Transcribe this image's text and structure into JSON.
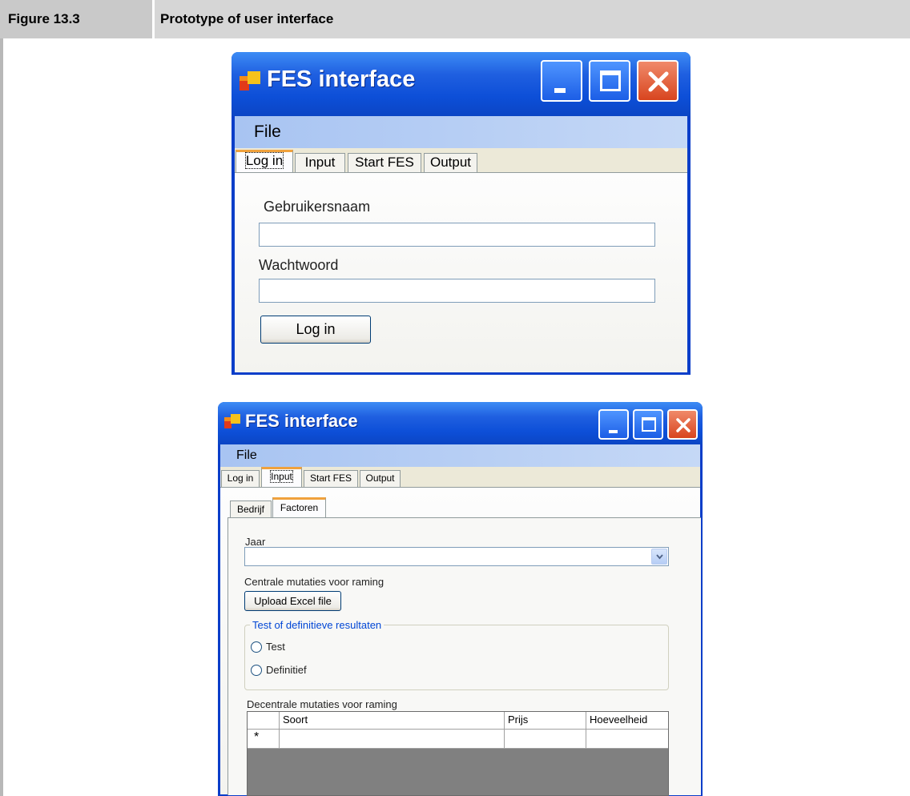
{
  "figure": {
    "number": "Figure 13.3",
    "title": "Prototype of user interface"
  },
  "window1": {
    "title": "FES interface",
    "menu": {
      "file": "File"
    },
    "tabs": [
      "Log in",
      "Input",
      "Start FES",
      "Output"
    ],
    "active_tab": "Log in",
    "username_label": "Gebruikersnaam",
    "username_value": "",
    "password_label": "Wachtwoord",
    "password_value": "",
    "login_button": "Log in"
  },
  "window2": {
    "title": "FES interface",
    "menu": {
      "file": "File"
    },
    "tabs": [
      "Log in",
      "Input",
      "Start FES",
      "Output"
    ],
    "active_tab": "Input",
    "subtabs": [
      "Bedrijf",
      "Factoren"
    ],
    "active_subtab": "Factoren",
    "jaar_label": "Jaar",
    "jaar_value": "",
    "central_label": "Centrale mutaties voor raming",
    "upload_button": "Upload Excel file",
    "group_title": "Test of definitieve resultaten",
    "radio_test": "Test",
    "radio_definitief": "Definitief",
    "decentral_label": "Decentrale mutaties voor raming",
    "grid": {
      "columns": [
        "Soort",
        "Prijs",
        "Hoeveelheid"
      ],
      "new_row_marker": "*"
    }
  },
  "colors": {
    "title_bar": "#0d4fd8",
    "close_button": "#d8451f",
    "active_tab_accent": "#f0a13c",
    "group_title": "#0046d5"
  }
}
